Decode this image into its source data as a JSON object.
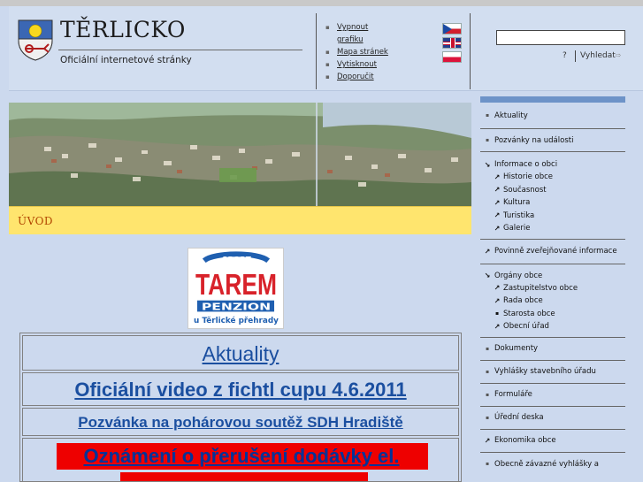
{
  "header": {
    "title": "TĚRLICKO",
    "subtitle": "Oficiální internetové stránky",
    "tools": [
      {
        "label": "Vypnout grafiku"
      },
      {
        "label": "Mapa stránek"
      },
      {
        "label": "Vytisknout"
      },
      {
        "label": "Doporučit"
      }
    ],
    "languages": [
      "cs",
      "en",
      "pl"
    ],
    "search": {
      "value": "",
      "help": "?",
      "button": "Vyhledat"
    }
  },
  "section": {
    "title": "ÚVOD"
  },
  "logo": {
    "sport": "SPORT",
    "name": "TAREM",
    "type": "PENZION",
    "location": "u Těrlické přehrady"
  },
  "news": [
    "Aktuality",
    "Oficiální video z fichtl cupu 4.6.2011",
    "Pozvánka na pohárovou soutěž SDH Hradiště",
    "Oznámení o přerušení dodávky el."
  ],
  "menu": {
    "items": [
      {
        "label": "Aktuality",
        "icon": "bullet"
      },
      {
        "label": "Pozvánky na události",
        "icon": "bullet"
      }
    ],
    "info": {
      "label": "Informace o obci",
      "sub": [
        "Historie obce",
        "Současnost",
        "Kultura",
        "Turistika",
        "Galerie"
      ]
    },
    "povinne": "Povinně zveřejňované informace",
    "organy": {
      "label": "Orgány obce",
      "sub": [
        "Zastupitelstvo obce",
        "Rada obce",
        "Starosta obce",
        "Obecní úřad"
      ]
    },
    "rest": [
      {
        "label": "Dokumenty",
        "icon": "bullet"
      },
      {
        "label": "Vyhlášky stavebního úřadu",
        "icon": "bullet"
      },
      {
        "label": "Formuláře",
        "icon": "bullet"
      },
      {
        "label": "Úřední deska",
        "icon": "bullet"
      },
      {
        "label": "Ekonomika obce",
        "icon": "arrow"
      },
      {
        "label": "Obecně závazné vyhlášky a",
        "icon": "bullet"
      }
    ]
  },
  "colors": {
    "accent": "#1b4fa0",
    "section_bar": "#ffe56e",
    "section_text": "#b14500",
    "alert": "#ee0000"
  }
}
